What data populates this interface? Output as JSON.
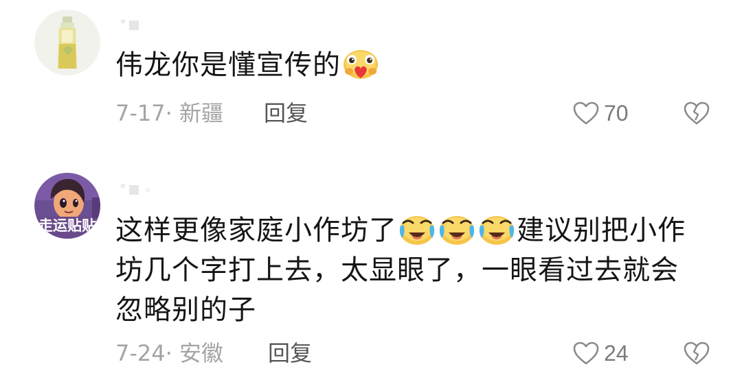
{
  "comments": [
    {
      "text": "伟龙你是懂宣传的",
      "emoji": "heart-hug-emoji",
      "date_location": "7-17· 新疆",
      "reply_label": "回复",
      "like_count": "70"
    },
    {
      "text_parts": [
        "这样更像家庭小作坊了",
        "建议别把小作坊几个字打上去，太显眼了，一眼看过去就会忽略别的子"
      ],
      "emoji": "crying-laughing-emoji",
      "avatar_badge": "走运贴贴",
      "date_location": "7-24· 安徽",
      "reply_label": "回复",
      "like_count": "24"
    }
  ],
  "colors": {
    "text": "#151515",
    "meta": "#a4a4a4",
    "reply": "#555555",
    "icon": "#8a8a8a"
  }
}
